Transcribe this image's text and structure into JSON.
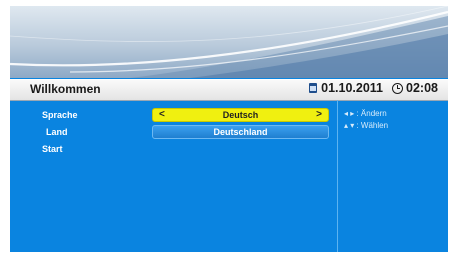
{
  "header": {
    "title": "Willkommen",
    "date": "01.10.2011",
    "time": "02:08",
    "date_icon": "calendar-icon",
    "time_icon": "clock-icon"
  },
  "settings": [
    {
      "label": "Sprache",
      "value": "Deutsch",
      "selected": true,
      "has_arrows": true
    },
    {
      "label": "Land",
      "value": "Deutschland",
      "selected": false
    },
    {
      "label": "Start"
    }
  ],
  "arrows": {
    "left": "<",
    "right": ">"
  },
  "help": {
    "change": "◂ ▸ : Ändern",
    "select": "▴ ▾ : Wählen"
  },
  "colors": {
    "background": "#0a84e0",
    "highlight": "#f0f010",
    "title_bar": "#ececec"
  }
}
